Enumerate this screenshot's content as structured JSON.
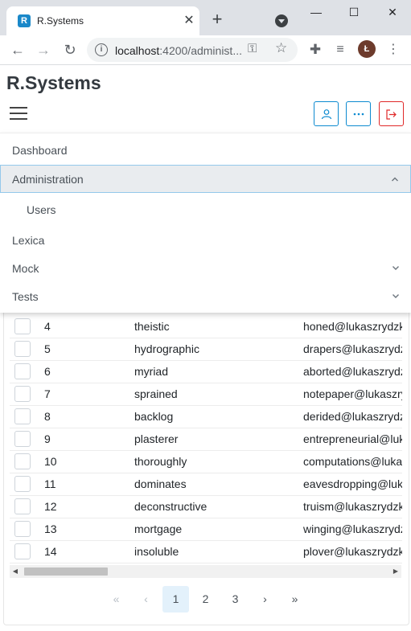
{
  "browser": {
    "tab_title": "R.Systems",
    "favicon_letter": "R",
    "url_host": "localhost",
    "url_rest": ":4200/administ...",
    "profile_initial": "Ł"
  },
  "app": {
    "brand": "R.Systems"
  },
  "menu": {
    "items": [
      {
        "label": "Dashboard",
        "has_chevron": false
      },
      {
        "label": "Administration",
        "has_chevron": true,
        "expanded": true,
        "active": true
      },
      {
        "label": "Users",
        "sub": true
      },
      {
        "label": "Lexica",
        "has_chevron": false
      },
      {
        "label": "Mock",
        "has_chevron": true,
        "expanded": false
      },
      {
        "label": "Tests",
        "has_chevron": true,
        "expanded": false
      }
    ]
  },
  "table": {
    "rows": [
      {
        "id": "4",
        "name": "theistic",
        "email": "honed@lukaszrydzkowski.pl"
      },
      {
        "id": "5",
        "name": "hydrographic",
        "email": "drapers@lukaszrydzkowski.pl"
      },
      {
        "id": "6",
        "name": "myriad",
        "email": "aborted@lukaszrydzkowski.pl"
      },
      {
        "id": "7",
        "name": "sprained",
        "email": "notepaper@lukaszrydzkowski.pl"
      },
      {
        "id": "8",
        "name": "backlog",
        "email": "derided@lukaszrydzkowski.pl"
      },
      {
        "id": "9",
        "name": "plasterer",
        "email": "entrepreneurial@lukaszrydzkowski.pl"
      },
      {
        "id": "10",
        "name": "thoroughly",
        "email": "computations@lukaszrydzkowski.pl"
      },
      {
        "id": "11",
        "name": "dominates",
        "email": "eavesdropping@lukaszrydzkowski.pl"
      },
      {
        "id": "12",
        "name": "deconstructive",
        "email": "truism@lukaszrydzkowski.pl"
      },
      {
        "id": "13",
        "name": "mortgage",
        "email": "winging@lukaszrydzkowski.pl"
      },
      {
        "id": "14",
        "name": "insoluble",
        "email": "plover@lukaszrydzkowski.pl"
      }
    ]
  },
  "pagination": {
    "first": "«",
    "prev": "‹",
    "pages": [
      "1",
      "2",
      "3"
    ],
    "current": "1",
    "next": "›",
    "last": "»"
  },
  "colors": {
    "accent": "#0d8ad0",
    "danger": "#e02828",
    "active_item_bg": "#e9ecef"
  }
}
